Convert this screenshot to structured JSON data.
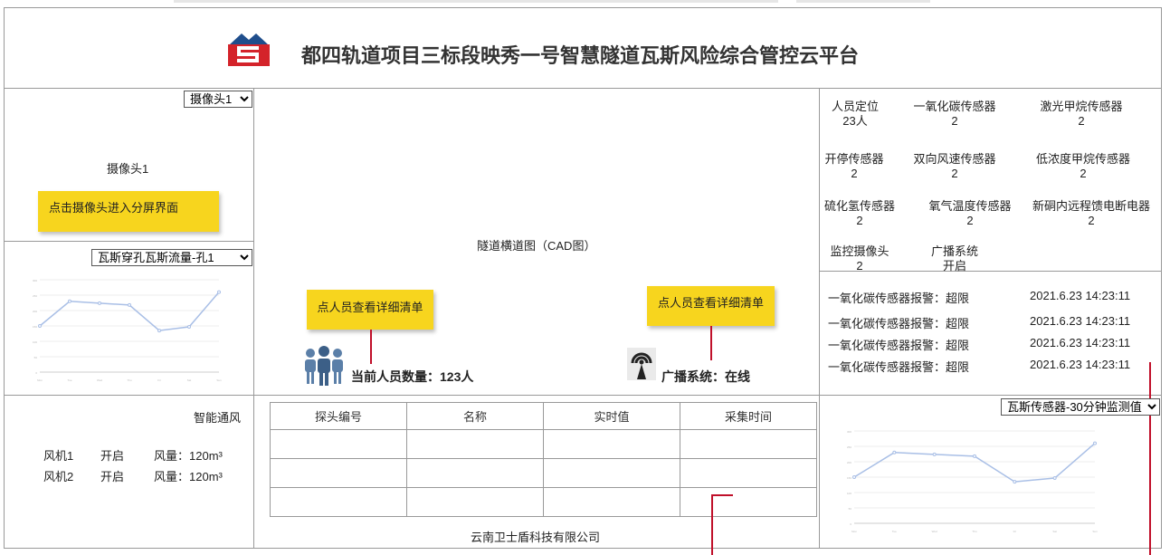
{
  "header": {
    "title": "都四轨道项目三标段映秀一号智慧隧道瓦斯风险综合管控云平台"
  },
  "camera": {
    "select_value": "摄像头1",
    "label": "摄像头1",
    "tip": "点击摄像头进入分屏界面"
  },
  "gas_flow": {
    "select_value": "瓦斯穿孔瓦斯流量-孔1"
  },
  "center": {
    "cad_label": "隧道横道图（CAD图）",
    "tip_people": "点人员查看详细清单",
    "tip_broadcast": "点人员查看详细清单",
    "people_count": "当前人员数量：123人",
    "broadcast_status": "广播系统：在线"
  },
  "sensors": [
    {
      "name": "人员定位",
      "value": "23人"
    },
    {
      "name": "一氧化碳传感器",
      "value": "2"
    },
    {
      "name": "激光甲烷传感器",
      "value": "2"
    },
    {
      "name": "开停传感器",
      "value": "2"
    },
    {
      "name": "双向风速传感器",
      "value": "2"
    },
    {
      "name": "低浓度甲烷传感器",
      "value": "2"
    },
    {
      "name": "硫化氢传感器",
      "value": "2"
    },
    {
      "name": "氧气温度传感器",
      "value": "2"
    },
    {
      "name": "新硐内远程馈电断电器",
      "value": "2"
    },
    {
      "name": "监控摄像头",
      "value": "2"
    },
    {
      "name": "广播系统",
      "value": "开启"
    }
  ],
  "alarms": [
    {
      "text": "一氧化碳传感器报警：超限",
      "time": "2021.6.23  14:23:11"
    },
    {
      "text": "一氧化碳传感器报警：超限",
      "time": "2021.6.23  14:23:11"
    },
    {
      "text": "一氧化碳传感器报警：超限",
      "time": "2021.6.23  14:23:11"
    },
    {
      "text": "一氧化碳传感器报警：超限",
      "time": "2021.6.23  14:23:11"
    }
  ],
  "ventilation": {
    "title": "智能通风",
    "fans": [
      {
        "name": "风机1",
        "status": "开启",
        "volume": "风量：120m³"
      },
      {
        "name": "风机2",
        "status": "开启",
        "volume": "风量：120m³"
      }
    ]
  },
  "probe_table": {
    "headers": [
      "探头编号",
      "名称",
      "实时值",
      "采集时间"
    ],
    "rows": [
      [
        "",
        "",
        "",
        ""
      ],
      [
        "",
        "",
        "",
        ""
      ],
      [
        "",
        "",
        "",
        ""
      ]
    ]
  },
  "footer": {
    "company": "云南卫士盾科技有限公司"
  },
  "gas_sensor": {
    "select_value": "瓦斯传感器-30分钟监测值"
  },
  "colors": {
    "tip_yellow": "#f7d51e",
    "line_blue": "#a9bfe6",
    "red": "#c0102a",
    "logo_blue": "#1f4e8c",
    "logo_red": "#d4232a"
  },
  "chart_data": [
    {
      "type": "line",
      "categories": [
        "Mon",
        "Tue",
        "Wed",
        "Thu",
        "Fri",
        "Sat",
        "Sun"
      ],
      "values": [
        150,
        230,
        224,
        218,
        135,
        147,
        260
      ],
      "ylim": [
        0,
        300
      ],
      "grid": true
    },
    {
      "type": "line",
      "categories": [
        "Mon",
        "Tue",
        "Wed",
        "Thu",
        "Fri",
        "Sat",
        "Sun"
      ],
      "values": [
        150,
        230,
        224,
        218,
        135,
        147,
        260
      ],
      "ylim": [
        0,
        300
      ],
      "grid": true
    }
  ]
}
